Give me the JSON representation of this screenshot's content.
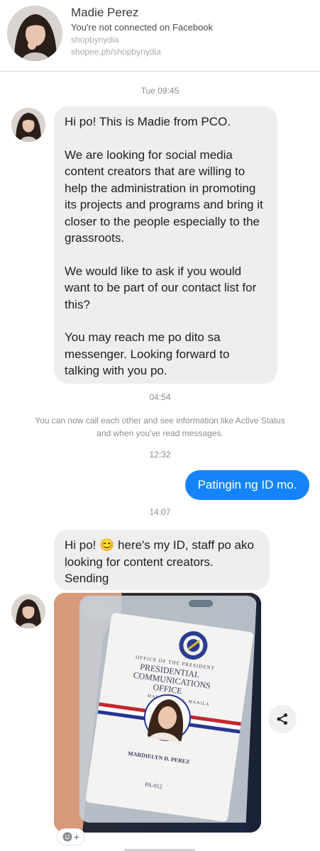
{
  "header": {
    "name": "Madie Perez",
    "subtitle": "You're not connected on Facebook",
    "link1": "shopbynydia",
    "link2": "shopee.ph/shopbynydia"
  },
  "timestamps": {
    "t1": "Tue 09:45",
    "t2": "04:54",
    "t3": "12:32",
    "t4": "14:07"
  },
  "messages": {
    "first": {
      "p1": "Hi po! This is Madie from PCO.",
      "p2": "We are looking for social media content creators that are willing to help the administration in promoting its projects and programs and bring it closer to the people especially to the grassroots.",
      "p3": "We would like to ask if you would want to be part of our contact list for this?",
      "p4": "You may reach me po dito sa messenger. Looking forward to talking with you po."
    },
    "notice": "You can now call each other and see information like Active Status and when you've read messages.",
    "outgoing": "Patingin ng ID mo.",
    "second": {
      "part1": "Hi po! ",
      "emoji": "😊",
      "part2": " here's my ID, staff po ako looking for content creators. Sending"
    }
  },
  "id_card": {
    "line1": "OFFICE OF THE PRESIDENT",
    "line2": "PRESIDENTIAL",
    "line3": "COMMUNICATIONS",
    "line4": "OFFICE",
    "line5": "MALACAÑANG, MANILA",
    "holder": "MARDIELYN D. PEREZ",
    "code": "PA-012"
  },
  "icons": {
    "share": "share-icon",
    "react": "add-reaction-icon"
  },
  "colors": {
    "outgoing_bubble": "#1584fb",
    "incoming_bubble": "#eeeeef"
  }
}
